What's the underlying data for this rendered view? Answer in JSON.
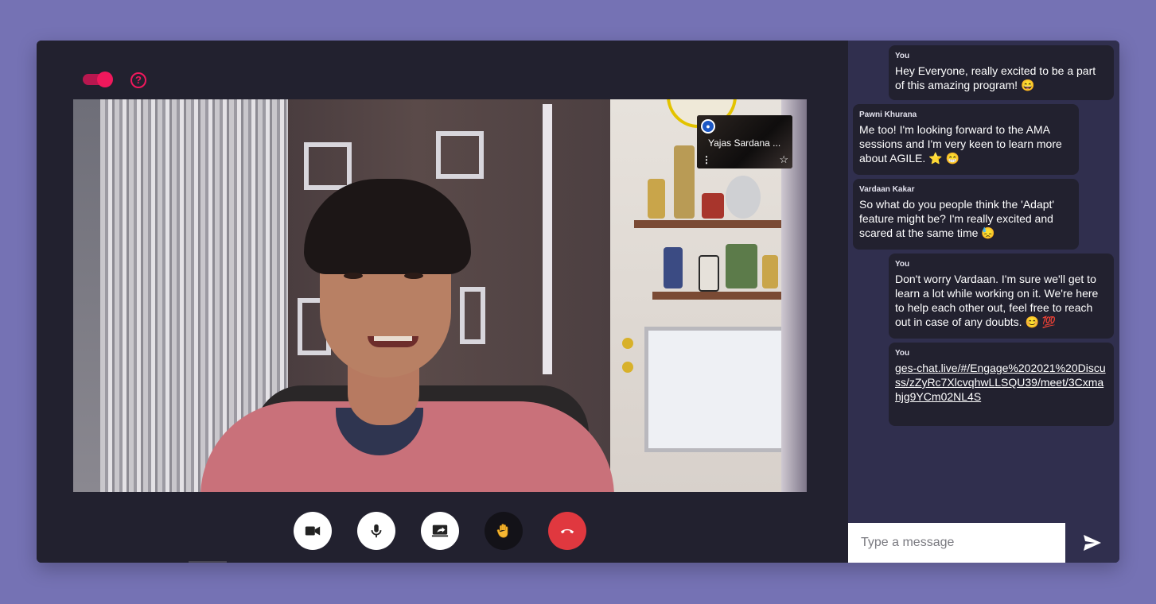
{
  "header": {
    "toggle_state": "on",
    "help_icon": "?"
  },
  "video": {
    "pip": {
      "avatar_icon": "person-badge-icon",
      "name": "Yajas Sardana ...",
      "more_icon": "⋮",
      "pin_icon": "☆"
    }
  },
  "controls": [
    {
      "name": "camera-button",
      "icon": "video-camera-icon"
    },
    {
      "name": "mic-button",
      "icon": "microphone-icon"
    },
    {
      "name": "share-screen-button",
      "icon": "screen-share-icon"
    },
    {
      "name": "raise-hand-button",
      "icon": "raised-hand-icon"
    },
    {
      "name": "end-call-button",
      "icon": "phone-hangup-icon"
    }
  ],
  "chat": {
    "messages": [
      {
        "sender": "You",
        "text": "Hey Everyone, really excited to be a part of this amazing program! 😄"
      },
      {
        "sender": "Pawni Khurana",
        "text": "Me too! I'm looking forward to the AMA sessions and I'm very keen to learn more about AGILE. ⭐ 😁"
      },
      {
        "sender": "Vardaan Kakar",
        "text": "So what do you people think the 'Adapt' feature might be? I'm really excited and scared at the same time 😓"
      },
      {
        "sender": "You",
        "text": "Don't worry Vardaan. I'm sure we'll get to learn a lot while working on it. We're here to help each other out, feel free to reach out in case of any doubts. 😊 💯"
      },
      {
        "sender": "You",
        "link": "ges-chat.live/#/Engage%202021%20Discuss/zZyRc7XlcvqhwLLSQU39/meet/3Cxmahjg9YCm02NL4S"
      }
    ],
    "input_placeholder": "Type a message",
    "send_icon": "send-icon"
  },
  "colors": {
    "page_bg": "#7572b4",
    "app_bg": "#22212f",
    "chat_bg": "#302f4e",
    "accent": "#f0185c",
    "end_call": "#e0383f"
  }
}
